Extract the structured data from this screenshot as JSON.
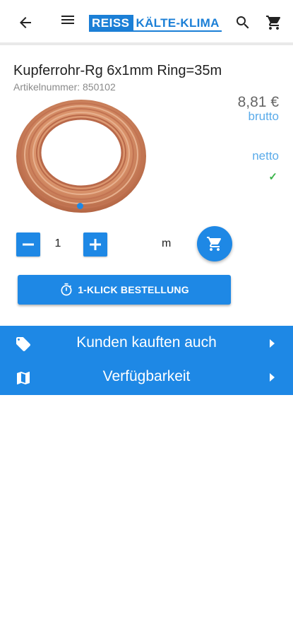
{
  "header": {
    "logo_part1": "REISS",
    "logo_part2": "KÄLTE-KLIMA",
    "back_icon": "arrow-back-icon",
    "menu_icon": "hamburger-menu-icon",
    "search_icon": "search-icon",
    "cart_icon": "shopping-cart-icon"
  },
  "product": {
    "title": "Kupferrohr-Rg 6x1mm Ring=35m",
    "article_number": "Artikelnummer: 850102",
    "price": "8,81 €",
    "brutto_label": "brutto",
    "netto_label": "netto",
    "availability_icon": "check-icon",
    "image": "copper-pipe-coil-image"
  },
  "quantity": {
    "value": "1",
    "unit": "m",
    "decrease_icon": "minus-icon",
    "increase_icon": "plus-icon",
    "add_to_cart_icon": "add-to-cart-icon"
  },
  "one_click": {
    "label": "1-KLICK BESTELLUNG",
    "icon": "stopwatch-icon"
  },
  "links": [
    {
      "label": "Kunden kauften auch",
      "icon": "tag-icon"
    },
    {
      "label": "Verfügbarkeit",
      "icon": "map-icon"
    }
  ],
  "colors": {
    "accent": "#1e88e5",
    "logo_blue": "#1b7fd6",
    "price_label": "#5aabea",
    "check": "#3bb44a"
  }
}
